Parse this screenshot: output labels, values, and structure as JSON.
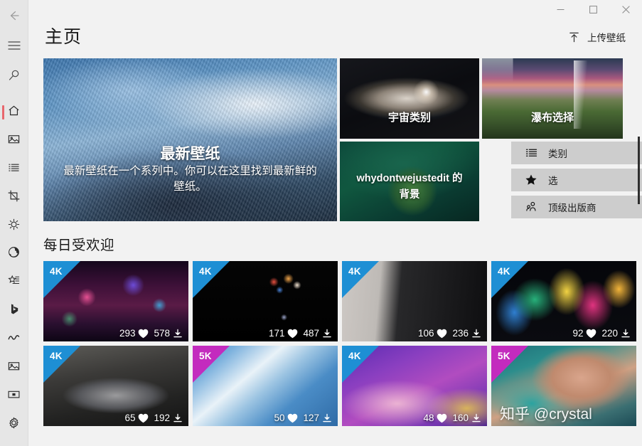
{
  "window": {
    "minimize_label": "─",
    "maximize_label": "☐",
    "close_label": "✕"
  },
  "sidebar": {
    "back_name": "back-arrow",
    "hamburger_name": "menu",
    "search_name": "search",
    "items": [
      {
        "name": "home",
        "selected": true
      },
      {
        "name": "images"
      },
      {
        "name": "list"
      },
      {
        "name": "crop"
      },
      {
        "name": "effects"
      },
      {
        "name": "globe"
      },
      {
        "name": "favorites"
      },
      {
        "name": "bing"
      },
      {
        "name": "trending"
      },
      {
        "name": "gallery"
      },
      {
        "name": "slideshow"
      }
    ],
    "settings_name": "settings"
  },
  "header": {
    "title": "主页",
    "upload_label": "上传壁纸"
  },
  "hero": {
    "main": {
      "title": "最新壁纸",
      "desc": "最新壁纸在一个系列中。你可以在这里找到最新鲜的壁纸。"
    },
    "space": {
      "title": "宇宙类别"
    },
    "waterfall": {
      "title": "瀑布选择"
    },
    "green": {
      "line1": "whydontwejustedit 的",
      "line2": "背景"
    }
  },
  "menu": {
    "items": [
      {
        "icon": "list-icon",
        "label": "类别"
      },
      {
        "icon": "star-icon",
        "label": "选"
      },
      {
        "icon": "people-icon",
        "label": "顶级出版商"
      }
    ]
  },
  "daily": {
    "section_title": "每日受欢迎",
    "badge_colors": {
      "4K": "#1e8fd4",
      "5K": "#c32bbe"
    },
    "rows": [
      [
        {
          "art": "art-city",
          "badge": "4K",
          "likes": "293",
          "downloads": "578"
        },
        {
          "art": "art-balloon",
          "badge": "4K",
          "likes": "171",
          "downloads": "487"
        },
        {
          "art": "art-car1",
          "badge": "4K",
          "likes": "106",
          "downloads": "236"
        },
        {
          "art": "art-fract",
          "badge": "4K",
          "likes": "92",
          "downloads": "220"
        }
      ],
      [
        {
          "art": "art-car2",
          "badge": "4K",
          "likes": "65",
          "downloads": "192"
        },
        {
          "art": "art-snow",
          "badge": "5K",
          "likes": "50",
          "downloads": "127"
        },
        {
          "art": "art-wave",
          "badge": "4K",
          "likes": "48",
          "downloads": "160"
        },
        {
          "art": "art-coast",
          "badge": "5K",
          "likes": "",
          "downloads": "",
          "watermark": "知乎 @crystal"
        }
      ]
    ]
  },
  "colors": {
    "accent": "#e8676d",
    "app_background": "#f2f2f2",
    "sidebar_background": "#e6e6e6",
    "menu_button": "#cdcdcd"
  }
}
